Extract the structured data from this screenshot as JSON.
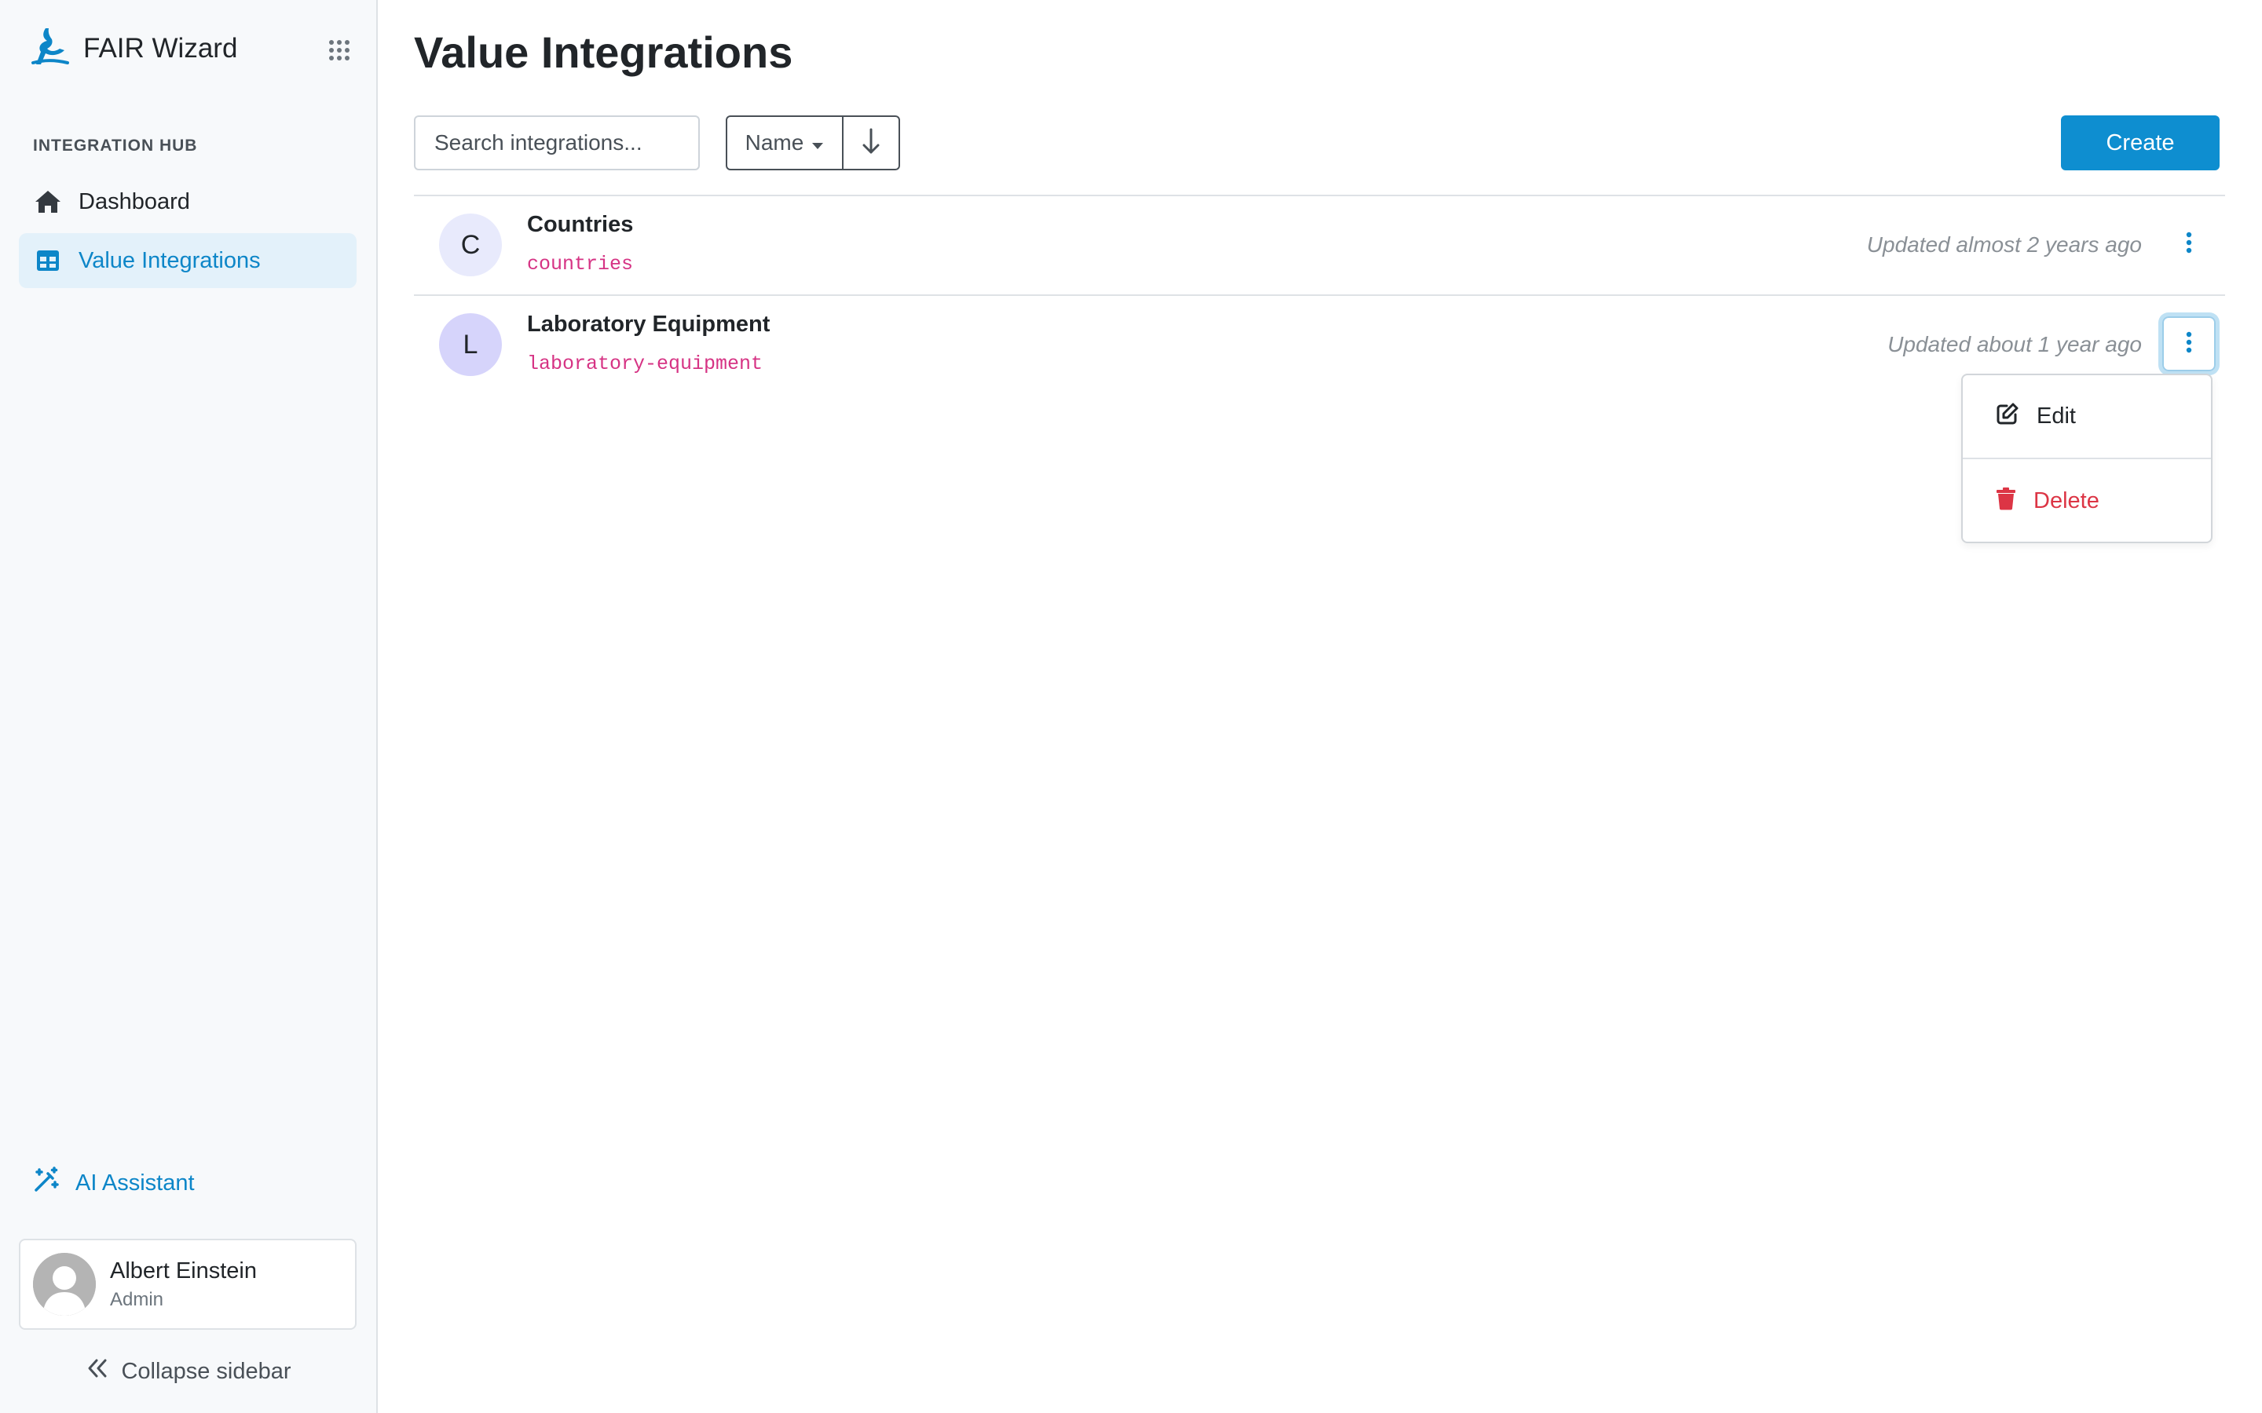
{
  "app": {
    "name": "FAIR Wizard"
  },
  "sidebar": {
    "section_label": "INTEGRATION HUB",
    "items": [
      {
        "label": "Dashboard",
        "icon": "home-icon",
        "active": false
      },
      {
        "label": "Value Integrations",
        "icon": "table-icon",
        "active": true
      }
    ],
    "ai_assistant": "AI Assistant",
    "profile": {
      "name": "Albert Einstein",
      "role": "Admin"
    },
    "collapse_label": "Collapse sidebar"
  },
  "main": {
    "title": "Value Integrations",
    "search": {
      "placeholder": "Search integrations...",
      "value": ""
    },
    "sort": {
      "field": "Name",
      "direction": "descending"
    },
    "create_label": "Create",
    "integrations": [
      {
        "initial": "C",
        "name": "Countries",
        "id": "countries",
        "updated": "Updated almost 2 years ago",
        "avatar_color": "#e8eafc"
      },
      {
        "initial": "L",
        "name": "Laboratory Equipment",
        "id": "laboratory-equipment",
        "updated": "Updated about 1 year ago",
        "avatar_color": "#d6d4fb"
      }
    ],
    "dropdown": {
      "edit_label": "Edit",
      "delete_label": "Delete"
    }
  },
  "colors": {
    "accent": "#0e8ed0",
    "danger": "#dc3545",
    "code": "#d63384"
  }
}
